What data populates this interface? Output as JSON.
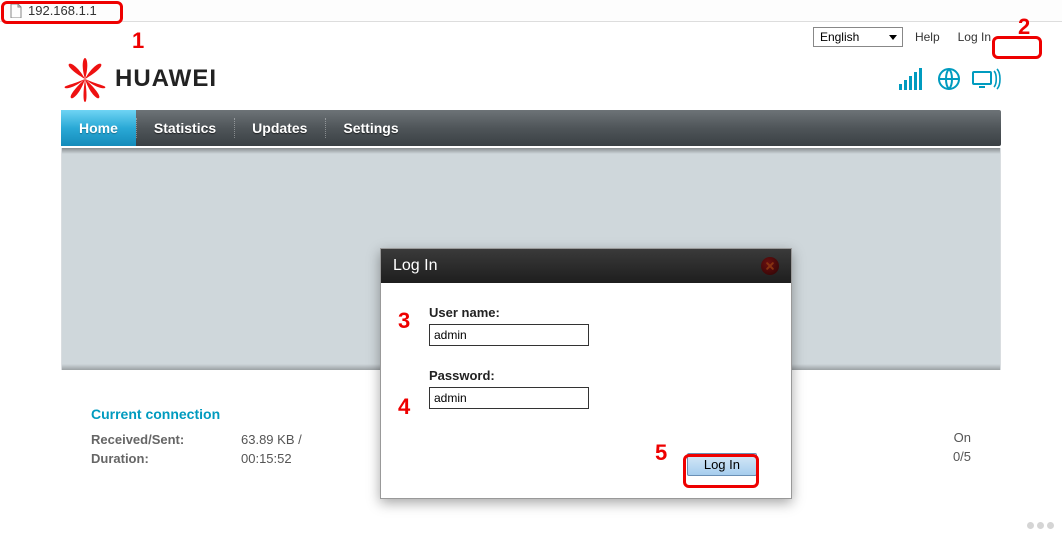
{
  "url": "192.168.1.1",
  "topbar": {
    "language_selected": "English",
    "help_label": "Help",
    "login_label": "Log In"
  },
  "brand": {
    "name": "HUAWEI"
  },
  "nav": [
    {
      "label": "Home",
      "active": true
    },
    {
      "label": "Statistics",
      "active": false
    },
    {
      "label": "Updates",
      "active": false
    },
    {
      "label": "Settings",
      "active": false
    }
  ],
  "sections": {
    "connection": {
      "heading": "Current connection",
      "received_sent_label": "Received/Sent:",
      "received_sent_value": "63.89 KB /",
      "duration_label": "Duration:",
      "duration_value": "00:15:52"
    },
    "right": {
      "val1": "On",
      "val2": "0/5"
    }
  },
  "login_modal": {
    "title": "Log In",
    "username_label": "User name:",
    "username_value": "admin",
    "password_label": "Password:",
    "password_value": "admin",
    "submit_label": "Log In"
  },
  "callouts": {
    "c1": "1",
    "c2": "2",
    "c3": "3",
    "c4": "4",
    "c5": "5"
  }
}
